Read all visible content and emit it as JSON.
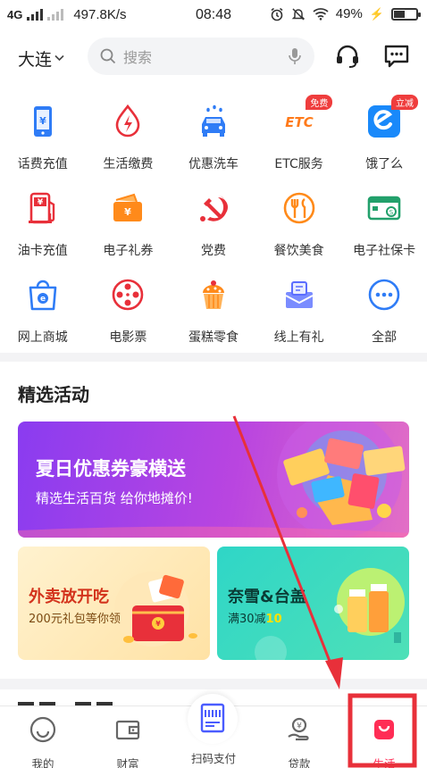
{
  "status_bar": {
    "network": "4G",
    "speed": "497.8K/s",
    "time": "08:48",
    "battery": "49%",
    "battery_level": 0.49
  },
  "header": {
    "city": "大连",
    "search_placeholder": "搜索",
    "icons": [
      "headset-icon",
      "message-icon",
      "microphone-icon",
      "search-icon"
    ]
  },
  "services": [
    {
      "label": "话费充值",
      "icon": "phone-recharge-icon"
    },
    {
      "label": "生活缴费",
      "icon": "utility-bill-icon"
    },
    {
      "label": "优惠洗车",
      "icon": "car-wash-icon"
    },
    {
      "label": "ETC服务",
      "icon": "etc-icon",
      "badge": "免费"
    },
    {
      "label": "饿了么",
      "icon": "eleme-icon",
      "badge": "立减"
    },
    {
      "label": "油卡充值",
      "icon": "fuel-card-icon"
    },
    {
      "label": "电子礼券",
      "icon": "gift-voucher-icon"
    },
    {
      "label": "党费",
      "icon": "party-fee-icon"
    },
    {
      "label": "餐饮美食",
      "icon": "dining-icon"
    },
    {
      "label": "电子社保卡",
      "icon": "social-security-card-icon"
    },
    {
      "label": "网上商城",
      "icon": "online-mall-icon"
    },
    {
      "label": "电影票",
      "icon": "movie-ticket-icon"
    },
    {
      "label": "蛋糕零食",
      "icon": "cake-icon"
    },
    {
      "label": "线上有礼",
      "icon": "online-gift-icon"
    },
    {
      "label": "全部",
      "icon": "more-icon"
    }
  ],
  "featured": {
    "title": "精选活动",
    "main_banner": {
      "title": "夏日优惠券豪横送",
      "subtitle": "精选生活百货 给你地摊价!"
    },
    "left_banner": {
      "title": "外卖放开吃",
      "subtitle": "200元礼包等你领"
    },
    "right_banner": {
      "title": "奈雪&台盖",
      "subtitle_prefix": "满30减",
      "subtitle_highlight": "10"
    }
  },
  "tabs": [
    {
      "label": "我的",
      "icon": "smiley-icon"
    },
    {
      "label": "财富",
      "icon": "wallet-icon"
    },
    {
      "label": "扫码支付",
      "icon": "scan-icon"
    },
    {
      "label": "贷款",
      "icon": "loan-icon"
    },
    {
      "label": "生活",
      "icon": "life-bag-icon",
      "active": true
    }
  ],
  "colors": {
    "accent": "#1677ff",
    "active_tab": "#ff2d55",
    "highlight_box": "#e8303a",
    "arrow": "#e8303a"
  }
}
